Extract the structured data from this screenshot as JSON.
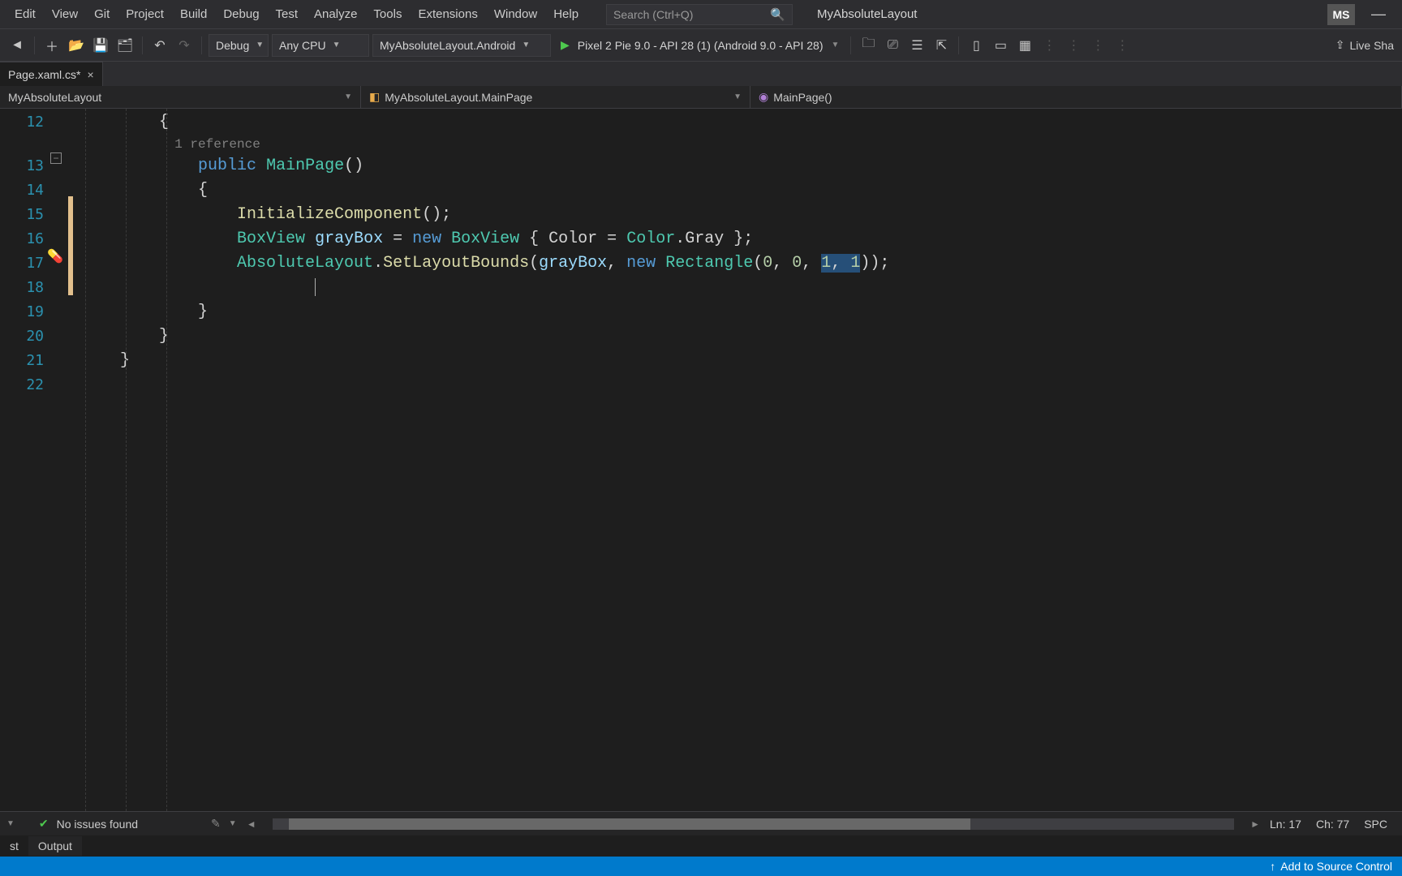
{
  "menu": {
    "items": [
      "Edit",
      "View",
      "Git",
      "Project",
      "Build",
      "Debug",
      "Test",
      "Analyze",
      "Tools",
      "Extensions",
      "Window",
      "Help"
    ],
    "search_placeholder": "Search (Ctrl+Q)",
    "solution_name": "MyAbsoluteLayout",
    "user_initials": "MS"
  },
  "toolbar": {
    "config": "Debug",
    "platform": "Any CPU",
    "startup_project": "MyAbsoluteLayout.Android",
    "device": "Pixel 2 Pie 9.0 - API 28 (1) (Android 9.0 - API 28)",
    "live_share": "Live Sha"
  },
  "tab": {
    "filename": "Page.xaml.cs*",
    "dirty_marker": "*"
  },
  "nav": {
    "project": "MyAbsoluteLayout",
    "class": "MyAbsoluteLayout.MainPage",
    "member": "MainPage()"
  },
  "code": {
    "lines_start": 12,
    "lines": [
      {
        "n": 12,
        "tokens": [
          {
            "t": "        {",
            "c": "punct"
          }
        ]
      },
      {
        "n": 13,
        "ref": "1 reference",
        "tokens": [
          {
            "t": "            ",
            "c": "punct"
          },
          {
            "t": "public",
            "c": "kw"
          },
          {
            "t": " ",
            "c": "punct"
          },
          {
            "t": "MainPage",
            "c": "mname"
          },
          {
            "t": "()",
            "c": "punct"
          }
        ]
      },
      {
        "n": 14,
        "tokens": [
          {
            "t": "            {",
            "c": "punct"
          }
        ]
      },
      {
        "n": 15,
        "tokens": [
          {
            "t": "                ",
            "c": "punct"
          },
          {
            "t": "InitializeComponent",
            "c": "method-name"
          },
          {
            "t": "();",
            "c": "punct"
          }
        ]
      },
      {
        "n": 16,
        "tokens": [
          {
            "t": "                ",
            "c": "punct"
          },
          {
            "t": "BoxView",
            "c": "type"
          },
          {
            "t": " ",
            "c": "punct"
          },
          {
            "t": "grayBox",
            "c": "local"
          },
          {
            "t": " = ",
            "c": "punct"
          },
          {
            "t": "new",
            "c": "kw"
          },
          {
            "t": " ",
            "c": "punct"
          },
          {
            "t": "BoxView",
            "c": "type"
          },
          {
            "t": " { ",
            "c": "punct"
          },
          {
            "t": "Color",
            "c": "member"
          },
          {
            "t": " = ",
            "c": "punct"
          },
          {
            "t": "Color",
            "c": "enum"
          },
          {
            "t": ".",
            "c": "punct"
          },
          {
            "t": "Gray",
            "c": "member"
          },
          {
            "t": " };",
            "c": "punct"
          }
        ]
      },
      {
        "n": 17,
        "tokens": [
          {
            "t": "                ",
            "c": "punct"
          },
          {
            "t": "AbsoluteLayout",
            "c": "type"
          },
          {
            "t": ".",
            "c": "punct"
          },
          {
            "t": "SetLayoutBounds",
            "c": "method-name"
          },
          {
            "t": "(",
            "c": "punct"
          },
          {
            "t": "grayBox",
            "c": "local"
          },
          {
            "t": ", ",
            "c": "punct"
          },
          {
            "t": "new",
            "c": "kw"
          },
          {
            "t": " ",
            "c": "punct"
          },
          {
            "t": "Rectangle",
            "c": "type"
          },
          {
            "t": "(",
            "c": "punct"
          },
          {
            "t": "0",
            "c": "num"
          },
          {
            "t": ", ",
            "c": "punct"
          },
          {
            "t": "0",
            "c": "num"
          },
          {
            "t": ", ",
            "c": "punct"
          },
          {
            "t": "1",
            "c": "num",
            "hl": true
          },
          {
            "t": ", ",
            "c": "punct",
            "hl": true
          },
          {
            "t": "1",
            "c": "num",
            "hl": true
          },
          {
            "t": "));",
            "c": "punct"
          }
        ]
      },
      {
        "n": 18,
        "tokens": [
          {
            "t": "",
            "c": "punct"
          }
        ],
        "cursor_indent": "                        "
      },
      {
        "n": 19,
        "tokens": [
          {
            "t": "            }",
            "c": "punct"
          }
        ]
      },
      {
        "n": 20,
        "tokens": [
          {
            "t": "        }",
            "c": "punct"
          }
        ]
      },
      {
        "n": 21,
        "tokens": [
          {
            "t": "    }",
            "c": "punct"
          }
        ]
      },
      {
        "n": 22,
        "tokens": [
          {
            "t": "",
            "c": "punct"
          }
        ]
      }
    ]
  },
  "errorbar": {
    "issues": "No issues found",
    "ln": "Ln: 17",
    "ch": "Ch: 77",
    "spc": "SPC"
  },
  "paneltabs": {
    "tabs": [
      "st",
      "Output"
    ]
  },
  "statusbar": {
    "source_control": "Add to Source Control"
  }
}
